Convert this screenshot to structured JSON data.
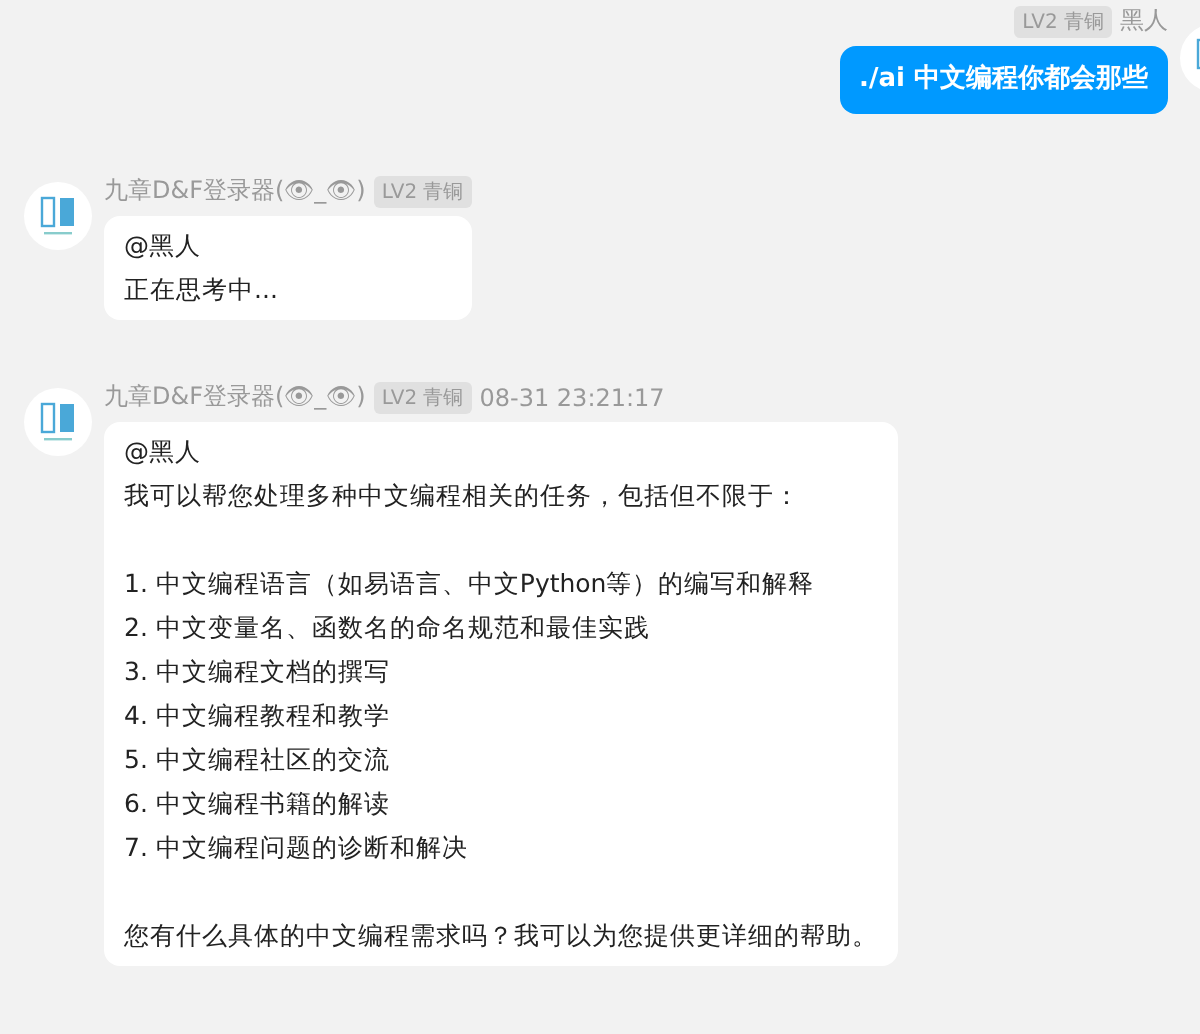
{
  "messages": [
    {
      "kind": "outgoing",
      "sender": "黑人",
      "badge": "LV2 青铜",
      "paragraphs": [
        [
          "./ai 中文编程你都会那些"
        ]
      ]
    },
    {
      "kind": "incoming",
      "sender": "九章D&F登录器(👁_👁)",
      "badge": "LV2 青铜",
      "paragraphs": [
        [
          "@黑人",
          "正在思考中..."
        ]
      ]
    },
    {
      "kind": "incoming",
      "sender": "九章D&F登录器(👁_👁)",
      "badge": "LV2 青铜",
      "time": "08-31 23:21:17",
      "paragraphs": [
        [
          "@黑人",
          "我可以帮您处理多种中文编程相关的任务，包括但不限于："
        ],
        [
          "1. 中文编程语言（如易语言、中文Python等）的编写和解释",
          "2. 中文变量名、函数名的命名规范和最佳实践",
          "3. 中文编程文档的撰写",
          "4. 中文编程教程和教学",
          "5. 中文编程社区的交流",
          "6. 中文编程书籍的解读",
          "7. 中文编程问题的诊断和解决"
        ],
        [
          "您有什么具体的中文编程需求吗？我可以为您提供更详细的帮助。"
        ]
      ]
    }
  ]
}
